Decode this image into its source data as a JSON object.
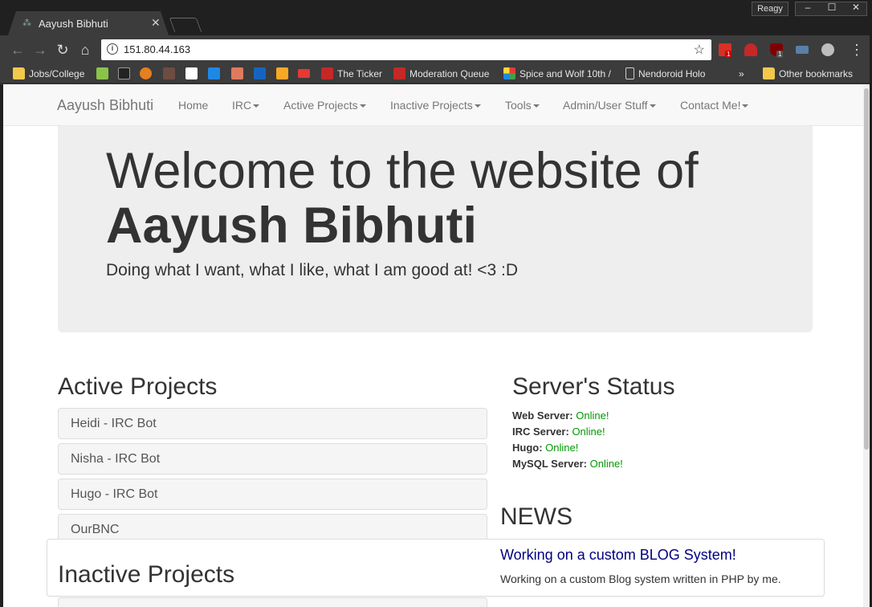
{
  "browser": {
    "tab_title": "Aayush Bibhuti",
    "profile_name": "Reagy",
    "url": "151.80.44.163",
    "extension_badges": [
      "1",
      "1"
    ],
    "bookmarks": [
      {
        "label": "Jobs/College",
        "icon": "folder-icon"
      },
      {
        "label": "",
        "icon": "ext-icon-1"
      },
      {
        "label": "",
        "icon": "ext-icon-2"
      },
      {
        "label": "",
        "icon": "ext-icon-3"
      },
      {
        "label": "",
        "icon": "ext-icon-4"
      },
      {
        "label": "",
        "icon": "amazon-icon"
      },
      {
        "label": "",
        "icon": "ext-icon-5"
      },
      {
        "label": "",
        "icon": "ext-icon-6"
      },
      {
        "label": "",
        "icon": "ext-icon-7"
      },
      {
        "label": "",
        "icon": "ext-icon-8"
      },
      {
        "label": "",
        "icon": "youtube-icon"
      },
      {
        "label": "The Ticker",
        "icon": "fp-icon"
      },
      {
        "label": "Moderation Queue",
        "icon": "fp-icon"
      },
      {
        "label": "Spice and Wolf 10th /",
        "icon": "pinwheel-icon"
      },
      {
        "label": "Nendoroid Holo",
        "icon": "page-icon"
      },
      {
        "label": "»",
        "icon": ""
      },
      {
        "label": "Other bookmarks",
        "icon": "folder-icon"
      }
    ]
  },
  "site": {
    "brand": "Aayush Bibhuti",
    "nav": [
      "Home",
      "IRC",
      "Active Projects",
      "Inactive Projects",
      "Tools",
      "Admin/User Stuff",
      "Contact Me!"
    ],
    "jumbotron": {
      "line1": "Welcome to the website of",
      "line2": "Aayush Bibhuti",
      "tagline": "Doing what I want, what I like, what I am good at! <3 :D"
    },
    "active_projects": {
      "heading": "Active Projects",
      "items": [
        "Heidi - IRC Bot",
        "Nisha - IRC Bot",
        "Hugo - IRC Bot",
        "OurBNC"
      ]
    },
    "inactive_projects": {
      "heading": "Inactive Projects"
    },
    "server_status": {
      "heading": "Server's Status",
      "rows": [
        {
          "label": "Web Server:",
          "value": "Online!"
        },
        {
          "label": "IRC Server:",
          "value": "Online!"
        },
        {
          "label": "Hugo:",
          "value": "Online!"
        },
        {
          "label": "MySQL Server:",
          "value": "Online!"
        }
      ]
    },
    "news": {
      "heading": "NEWS",
      "title": "Working on a custom BLOG System!",
      "body": "Working on a custom Blog system written in PHP by me."
    }
  },
  "colors": {
    "online": "#009900",
    "news_link": "#000080",
    "jumbotron_bg": "#eeeeee",
    "navbar_bg": "#f8f8f8"
  }
}
